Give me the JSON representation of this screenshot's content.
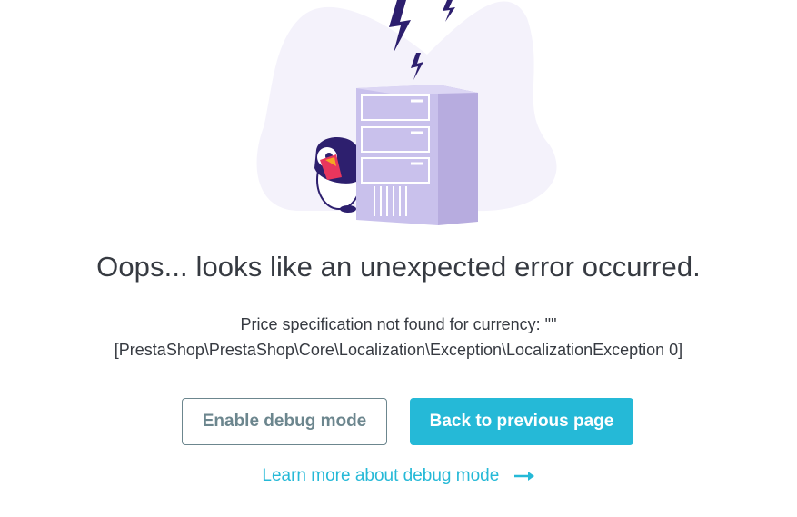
{
  "error_page": {
    "title": "Oops... looks like an unexpected error occurred.",
    "message_line1": "Price specification not found for currency: \"\"",
    "message_line2": "[PrestaShop\\PrestaShop\\Core\\Localization\\Exception\\LocalizationException 0]",
    "enable_debug_label": "Enable debug mode",
    "back_label": "Back to previous page",
    "learn_more_label": "Learn more about debug mode"
  },
  "colors": {
    "accent": "#25b9d7",
    "secondary": "#6c868e",
    "text": "#363a41",
    "server": "#c9c1ec",
    "blob": "#f4f2fb"
  },
  "icons": [
    "server-illustration",
    "lightning-icon",
    "puffin-mascot",
    "arrow-right-icon"
  ]
}
